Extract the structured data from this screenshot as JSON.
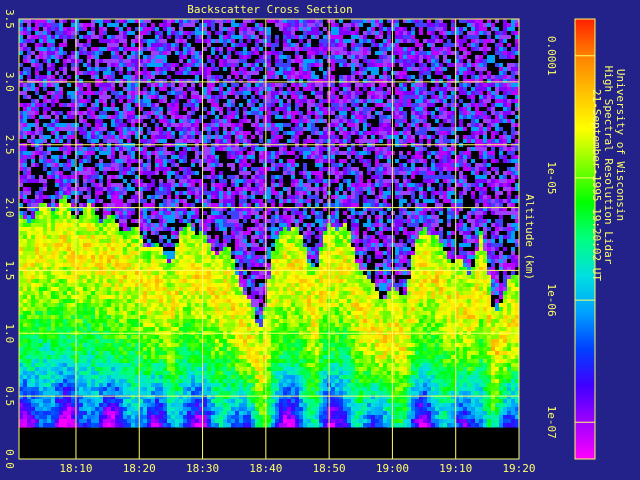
{
  "chart_data": {
    "type": "heatmap",
    "title": "Backscatter Cross Section",
    "xlabel": "",
    "ylabel": "Altitude (km)",
    "x_ticks": [
      "18:10",
      "18:20",
      "18:30",
      "18:40",
      "18:50",
      "19:00",
      "19:10",
      "19:20"
    ],
    "x_range_minutes_after_1800": [
      1,
      80
    ],
    "x_tick_values_minutes_after_1800": [
      10,
      20,
      30,
      40,
      50,
      60,
      70,
      80
    ],
    "y_ticks": [
      "0.0",
      "0.5",
      "1.0",
      "1.5",
      "2.0",
      "2.5",
      "3.0",
      "3.5"
    ],
    "y_tick_values": [
      0.0,
      0.5,
      1.0,
      1.5,
      2.0,
      2.5,
      3.0,
      3.5
    ],
    "ylim": [
      0.0,
      3.5
    ],
    "data_bottom_altitude": 0.25,
    "grid": true,
    "colorbar": {
      "scale": "log",
      "range": [
        5e-08,
        0.0002
      ],
      "tick_labels": [
        "0.0001",
        "1e-05",
        "1e-06",
        "1e-07"
      ],
      "tick_values": [
        0.0001,
        1e-05,
        1e-06,
        1e-07
      ],
      "colormap": [
        "#ff00ff",
        "#a000ff",
        "#4000ff",
        "#0040ff",
        "#00a0ff",
        "#00e0e0",
        "#00ff80",
        "#00ff00",
        "#80ff00",
        "#ffff00",
        "#ffc000",
        "#ff8000",
        "#ff2000"
      ]
    },
    "cloud_top_profile": {
      "x": [
        1,
        5,
        8,
        10,
        12,
        15,
        18,
        22,
        25,
        28,
        31,
        34,
        37,
        39,
        41,
        43,
        45,
        48,
        50,
        53,
        56,
        59,
        62,
        65,
        68,
        70,
        72,
        74,
        76,
        78,
        80
      ],
      "top_altitude_km": [
        1.9,
        2.0,
        2.05,
        1.95,
        2.0,
        1.9,
        1.85,
        1.7,
        1.6,
        1.9,
        1.7,
        1.65,
        1.3,
        1.0,
        1.6,
        1.9,
        1.8,
        1.5,
        1.9,
        1.8,
        1.4,
        1.3,
        1.35,
        1.9,
        1.65,
        1.6,
        1.45,
        1.8,
        1.2,
        1.35,
        1.5
      ]
    }
  },
  "side_text": {
    "line1": "University of Wisconsin",
    "line2": "High Spectral Resolution Lidar",
    "line3": "21-September-1995 19:20:02 UT"
  },
  "colors": {
    "background": "#22228a",
    "text": "#ffff66",
    "grid": "#ffff66",
    "no_data": "#000000",
    "clear_air": "#4a0a7a"
  }
}
